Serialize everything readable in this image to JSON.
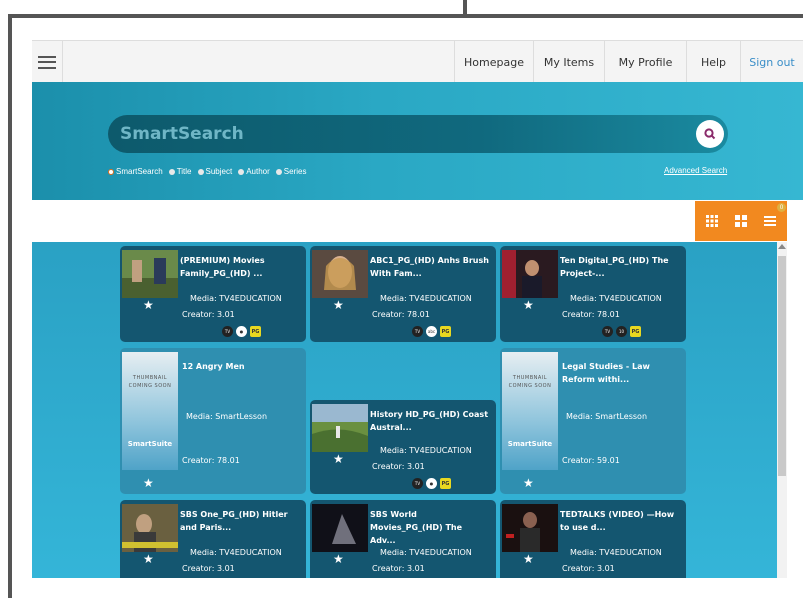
{
  "navbar": {
    "items": [
      {
        "label": "Homepage"
      },
      {
        "label": "My Items"
      },
      {
        "label": "My Profile"
      },
      {
        "label": "Help"
      },
      {
        "label": "Sign out"
      }
    ]
  },
  "search": {
    "placeholder": "SmartSearch",
    "options": [
      "SmartSearch",
      "Title",
      "Subject",
      "Author",
      "Series"
    ],
    "selected": "SmartSearch",
    "advanced_label": "Advanced Search"
  },
  "view": {
    "badge": "0"
  },
  "cards": [
    {
      "title": "(PREMIUM) Movies Family_PG_(HD) ...",
      "media_label": "Media:",
      "media": "TV4EDUCATION",
      "creator_label": "Creator:",
      "creator": "3.01"
    },
    {
      "title": "ABC1_PG_(HD) Anhs Brush With Fam...",
      "media_label": "Media:",
      "media": "TV4EDUCATION",
      "creator_label": "Creator:",
      "creator": "78.01"
    },
    {
      "title": "Ten Digital_PG_(HD) The Project-...",
      "media_label": "Media:",
      "media": "TV4EDUCATION",
      "creator_label": "Creator:",
      "creator": "78.01"
    },
    {
      "title": "12 Angry Men",
      "media_label": "Media:",
      "media": "SmartLesson",
      "creator_label": "Creator:",
      "creator": "78.01",
      "thumb_text": "THUMBNAIL COMING SOON",
      "brand": "SmartSuite"
    },
    {
      "title": "History HD_PG_(HD) Coast Austral...",
      "media_label": "Media:",
      "media": "TV4EDUCATION",
      "creator_label": "Creator:",
      "creator": "3.01"
    },
    {
      "title": "Legal Studies - Law Reform withi...",
      "media_label": "Media:",
      "media": "SmartLesson",
      "creator_label": "Creator:",
      "creator": "59.01",
      "thumb_text": "THUMBNAIL COMING SOON",
      "brand": "SmartSuite"
    },
    {
      "title": "SBS One_PG_(HD) Hitler and Paris...",
      "media_label": "Media:",
      "media": "TV4EDUCATION",
      "creator_label": "Creator:",
      "creator": "3.01"
    },
    {
      "title": "SBS World Movies_PG_(HD) The Adv...",
      "media_label": "Media:",
      "media": "TV4EDUCATION",
      "creator_label": "Creator:",
      "creator": "3.01"
    },
    {
      "title": "TEDTALKS (VIDEO) —How to use d...",
      "media_label": "Media:",
      "media": "TV4EDUCATION",
      "creator_label": "Creator:",
      "creator": "3.01"
    }
  ],
  "rating": {
    "label": "PG"
  },
  "colors": {
    "accent": "#f2891f",
    "hero": "#2aa8c4",
    "card": "#145670",
    "link": "#3a8ec8"
  }
}
